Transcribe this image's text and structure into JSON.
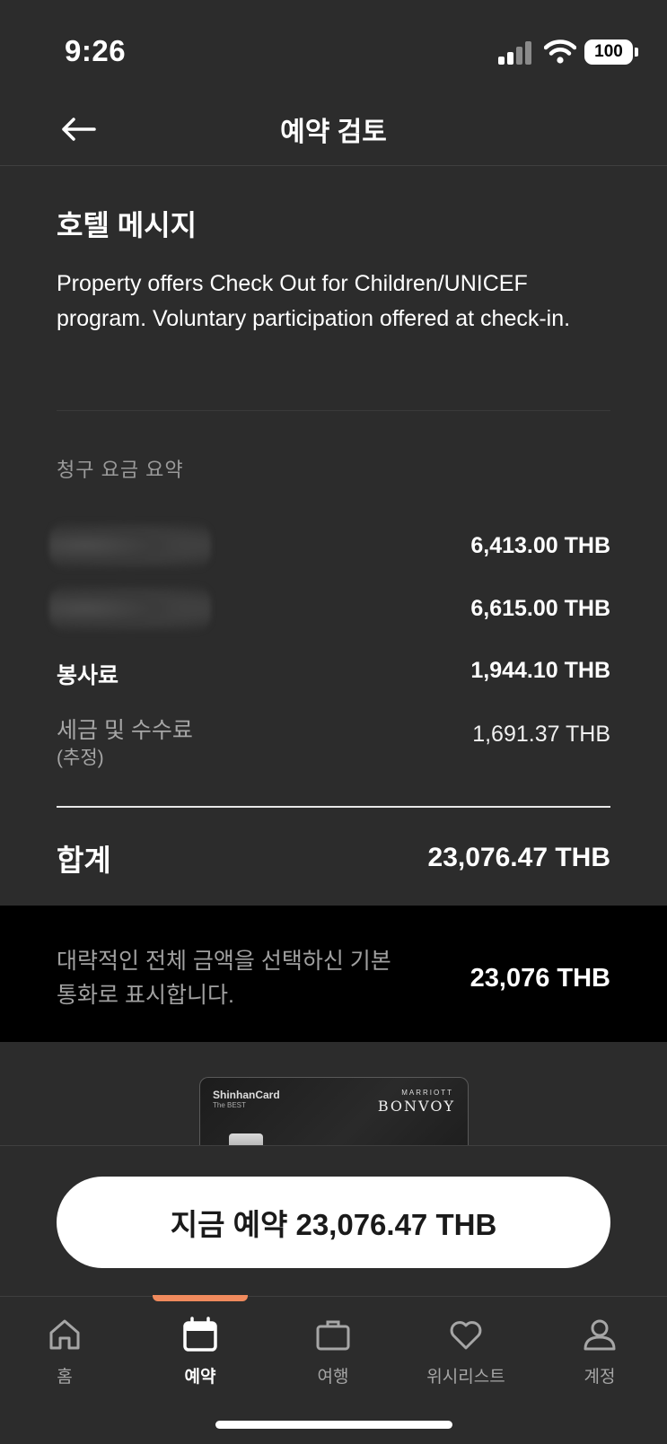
{
  "status_bar": {
    "time": "9:26",
    "battery": "100"
  },
  "header": {
    "title": "예약 검토",
    "back_icon": "arrow-left-icon"
  },
  "hotel_message": {
    "title": "호텔 메시지",
    "body": "Property offers Check Out for Children/UNICEF program. Voluntary participation offered at check-in."
  },
  "billing": {
    "title": "청구 요금 요약",
    "lines": [
      {
        "label": "",
        "amount": "6,413.00 THB"
      },
      {
        "label": "",
        "amount": "6,615.00 THB"
      },
      {
        "label": "봉사료",
        "amount": "1,944.10 THB"
      },
      {
        "label": "세금 및 수수료",
        "label_sub": "(추정)",
        "amount": "1,691.37 THB"
      }
    ],
    "total_label": "합계",
    "total_amount": "23,076.47 THB"
  },
  "currency_notice": {
    "text": "대략적인 전체 금액을 선택하신 기본 통화로 표시합니다.",
    "amount": "23,076 THB"
  },
  "card_promo": {
    "brand": "ShinhanCard",
    "sub": "The BEST",
    "marriott": "MARRIOTT",
    "bonvoy": "BONVOY"
  },
  "cta": {
    "label": "지금 예약 23,076.47 THB"
  },
  "tabs": [
    {
      "label": "홈",
      "icon": "home-icon",
      "active": false
    },
    {
      "label": "예약",
      "icon": "calendar-icon",
      "active": true
    },
    {
      "label": "여행",
      "icon": "briefcase-icon",
      "active": false
    },
    {
      "label": "위시리스트",
      "icon": "heart-icon",
      "active": false
    },
    {
      "label": "계정",
      "icon": "user-icon",
      "active": false
    }
  ],
  "colors": {
    "background": "#2c2c2c",
    "accent": "#f08a5d",
    "band": "#000000"
  }
}
